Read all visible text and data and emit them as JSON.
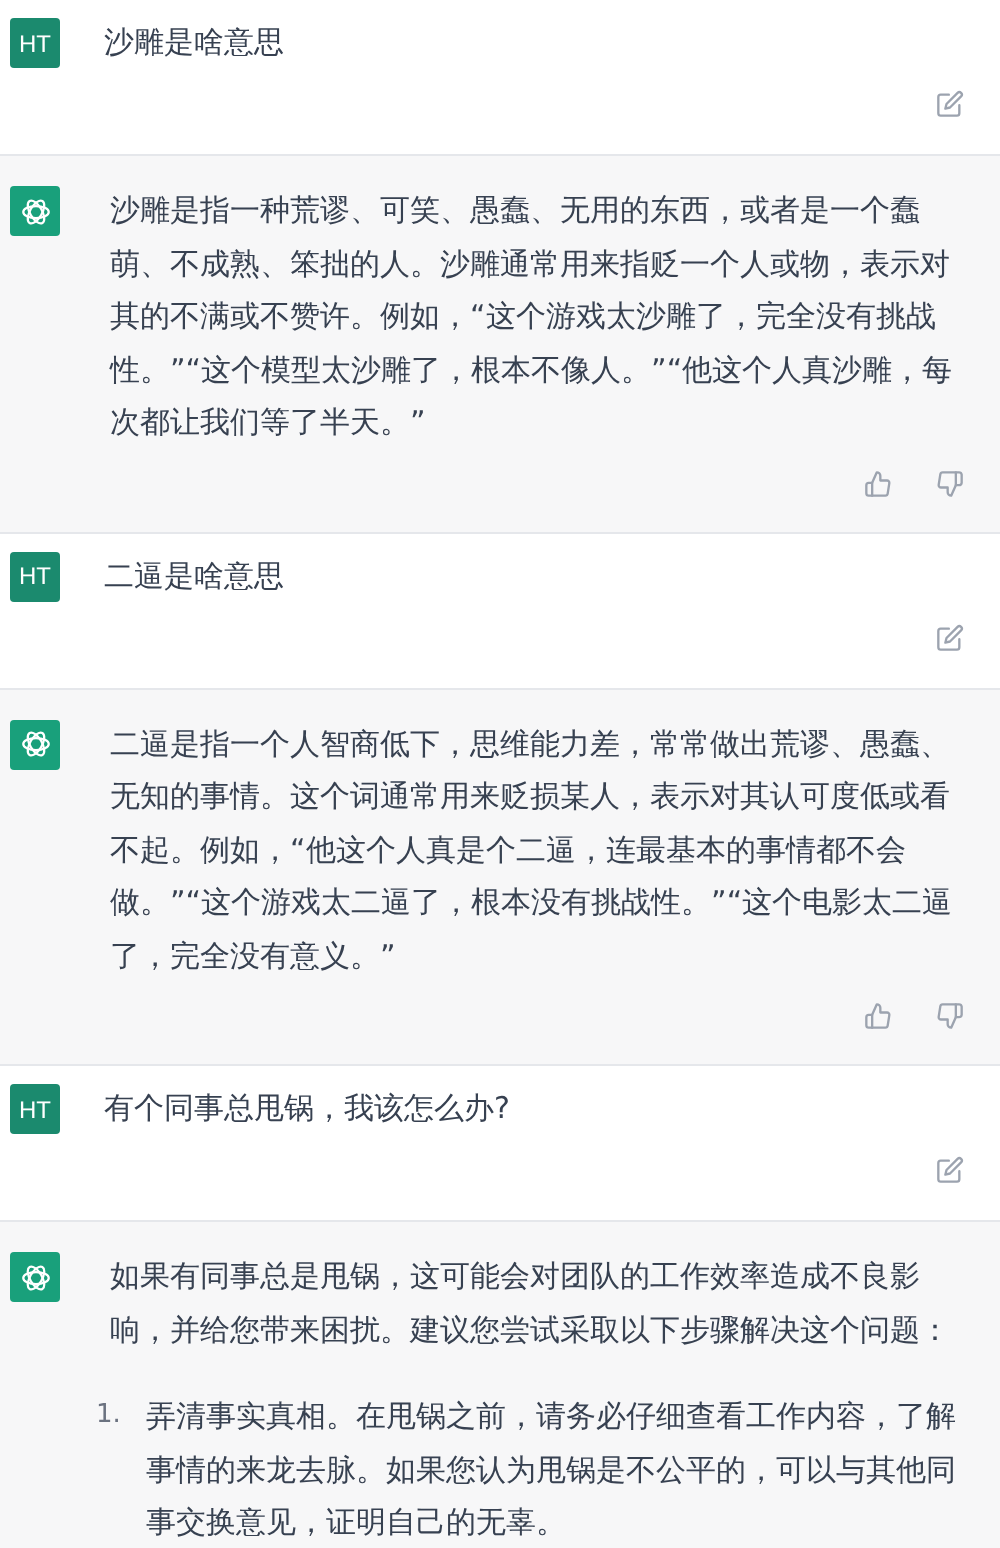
{
  "messages": [
    {
      "kind": "user",
      "avatar": "HT",
      "text": "沙雕是啥意思"
    },
    {
      "kind": "assistant",
      "paragraphs": [
        "沙雕是指一种荒谬、可笑、愚蠢、无用的东西，或者是一个蠢萌、不成熟、笨拙的人。沙雕通常用来指贬一个人或物，表示对其的不满或不赞许。例如，“这个游戏太沙雕了，完全没有挑战性。”“这个模型太沙雕了，根本不像人。”“他这个人真沙雕，每次都让我们等了半天。”"
      ]
    },
    {
      "kind": "user",
      "avatar": "HT",
      "text": "二逼是啥意思"
    },
    {
      "kind": "assistant",
      "paragraphs": [
        "二逼是指一个人智商低下，思维能力差，常常做出荒谬、愚蠢、无知的事情。这个词通常用来贬损某人，表示对其认可度低或看不起。例如，“他这个人真是个二逼，连最基本的事情都不会做。”“这个游戏太二逼了，根本没有挑战性。”“这个电影太二逼了，完全没有意义。”"
      ]
    },
    {
      "kind": "user",
      "avatar": "HT",
      "text": "有个同事总甩锅，我该怎么办?"
    },
    {
      "kind": "assistant",
      "paragraphs": [
        "如果有同事总是甩锅，这可能会对团队的工作效率造成不良影响，并给您带来困扰。建议您尝试采取以下步骤解决这个问题："
      ],
      "list": [
        {
          "number": "1.",
          "text": "弄清事实真相。在甩锅之前，请务必仔细查看工作内容，了解事情的来龙去脉。如果您认为甩锅是不公平的，可以与其他同事交换意见，证明自己的无辜。"
        }
      ]
    }
  ]
}
